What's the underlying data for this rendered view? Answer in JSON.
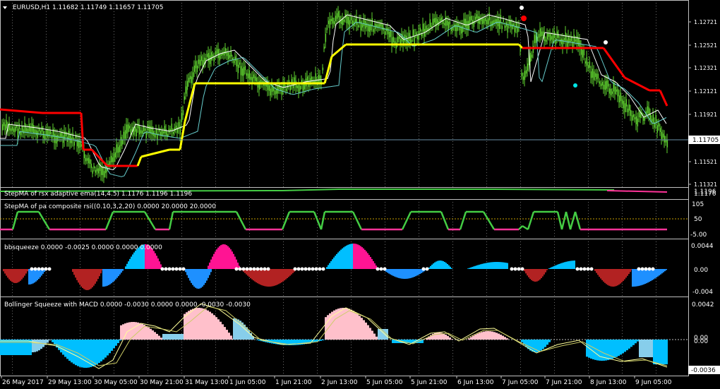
{
  "colors": {
    "background": "#000000",
    "frame": "#c0c0c0",
    "grid": "#c0c0c0",
    "text": "#ffffff",
    "candle": "#5fd32f",
    "candle_wick": "#5fd32f",
    "step_ma_red": "#ff0000",
    "step_ma_yellow": "#ffff00",
    "ma_white": "#ffffff",
    "ma_cyan": "#66cccc",
    "price_line": "#6a8fa8",
    "green_line": "#44cc44",
    "magenta_line": "#ff3399",
    "deep_sky": "#00bfff",
    "dodger": "#1e90ff",
    "firebrick": "#b22222",
    "deep_pink": "#ff1493",
    "pink": "#ffc0cb",
    "sky": "#87ceeb",
    "macd_line": "#ffff99",
    "dot_white": "#ffffff",
    "dot_red": "#ff0000",
    "dot_cyan": "#00e5e5",
    "level_dotted": "#c0c0c0",
    "level_50": "#c8a000",
    "triangle_icon": "#ffffff"
  },
  "main": {
    "title": "EURUSD,H1  1.11682 1.11749 1.11657 1.11705",
    "price_labels": [
      "1.12721",
      "1.12521",
      "1.12321",
      "1.12121",
      "1.11921",
      "1.11521",
      "1.11321"
    ],
    "current_price": "1.11705"
  },
  "sub1": {
    "title": "StepMA of rsx adaptive ema(14,4.5) 1.1176 1.1196 1.1196",
    "right_labels": [
      "1.1196",
      "1.1176"
    ]
  },
  "sub2": {
    "title": "StepMA of pa composite rsi((0.10,3,2,20) 0.0000 20.0000 20.0000",
    "right_labels": [
      "105",
      "50",
      "-5.00"
    ]
  },
  "sub3": {
    "title": "bbsqueeze 0.0000 -0.0025 0.0000 0.0000 0.0000",
    "right_labels": [
      "0.0044",
      "0.00",
      "-0.004"
    ]
  },
  "sub4": {
    "title": "Bollinger Squeeze with MACD 0.0000 -0.0030 0.0000 0.0000 -0.0030 -0.0030",
    "right_labels": [
      "0.0042",
      "0.00",
      "0.00",
      "-0.0036"
    ]
  },
  "time_labels": [
    "26 May 2017",
    "29 May 13:00",
    "30 May 05:00",
    "30 May 21:00",
    "31 May 13:00",
    "1 Jun 05:00",
    "1 Jun 21:00",
    "2 Jun 13:00",
    "5 Jun 05:00",
    "5 Jun 21:00",
    "6 Jun 13:00",
    "7 Jun 05:00",
    "7 Jun 21:00",
    "8 Jun 13:00",
    "9 Jun 05:00"
  ],
  "icons": {
    "triangle": "triangle-down-icon"
  }
}
